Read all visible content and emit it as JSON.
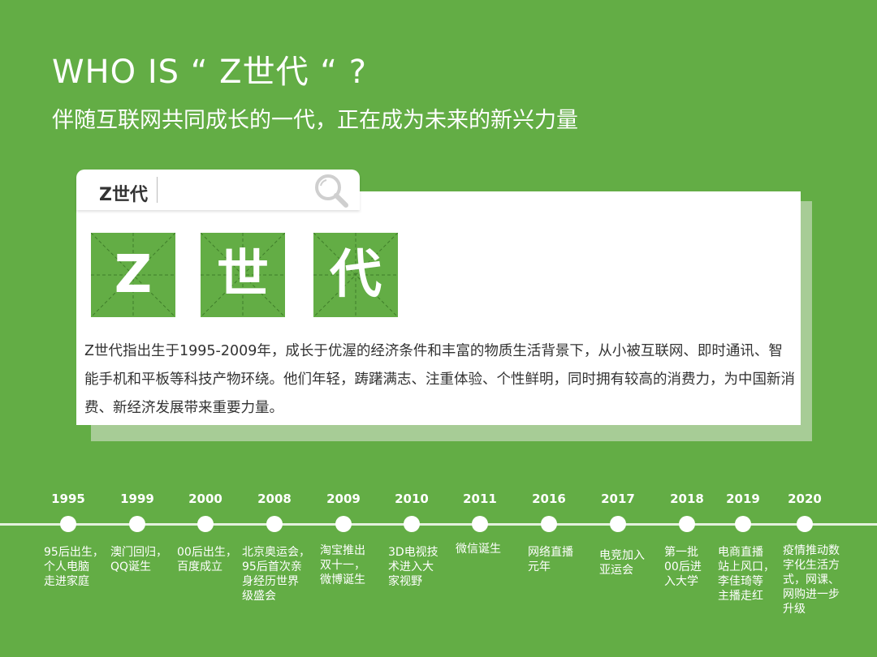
{
  "header": {
    "title": "WHO IS   “ Z世代 “ ?",
    "subtitle": "伴随互联网共同成长的一代，正在成为未来的新兴力量"
  },
  "search": {
    "term": "Z世代",
    "icon": "search-icon"
  },
  "glyphs": [
    "Z",
    "世",
    "代"
  ],
  "description": "Z世代指出生于1995-2009年，成长于优渥的经济条件和丰富的物质生活背景下，从小被互联网、即时通讯、智能手机和平板等科技产物环绕。他们年轻，踌躇满志、注重体验、个性鲜明，同时拥有较高的消费力，为中国新消费、新经济发展带来重要力量。",
  "timeline": [
    {
      "year": "1995",
      "event": "95后出生，\n个人电脑\n走进家庭"
    },
    {
      "year": "1999",
      "event": "澳门回归，\nQQ诞生"
    },
    {
      "year": "2000",
      "event": "00后出生，\n百度成立"
    },
    {
      "year": "2008",
      "event": "北京奥运会，\n95后首次亲\n身经历世界\n级盛会"
    },
    {
      "year": "2009",
      "event": "淘宝推出\n双十一，\n微博诞生"
    },
    {
      "year": "2010",
      "event": "3D电视技\n术进入大\n家视野"
    },
    {
      "year": "2011",
      "event": "微信诞生"
    },
    {
      "year": "2016",
      "event": "网络直播\n元年"
    },
    {
      "year": "2017",
      "event": "电竞加入\n亚运会"
    },
    {
      "year": "2018",
      "event": "第一批\n00后进\n入大学"
    },
    {
      "year": "2019",
      "event": "电商直播\n站上风口，\n李佳琦等\n主播走红"
    },
    {
      "year": "2020",
      "event": "疫情推动数\n字化生活方\n式，网课、\n网购进一步\n升级"
    }
  ],
  "colors": {
    "background": "#63ad45",
    "card": "#ffffff",
    "card_shadow": "#a7cc96",
    "text_dark": "#333333"
  }
}
